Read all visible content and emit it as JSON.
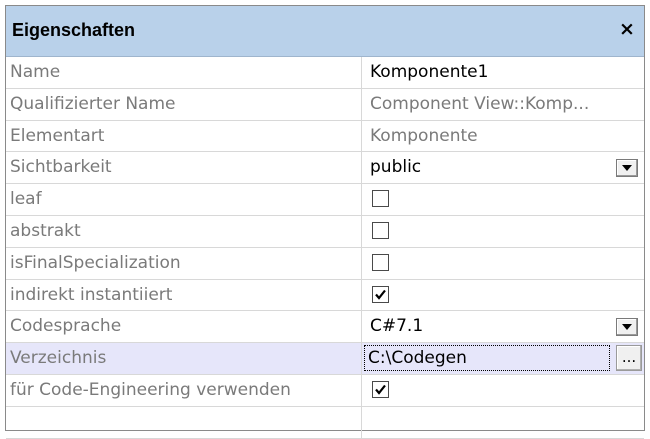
{
  "panel": {
    "title": "Eigenschaften",
    "close_label": "×"
  },
  "properties": {
    "name": {
      "label": "Name",
      "value": "Komponente1"
    },
    "qualified_name": {
      "label": "Qualifizierter Name",
      "value": "Component View::Komp..."
    },
    "element_type": {
      "label": "Elementart",
      "value": "Komponente"
    },
    "visibility": {
      "label": "Sichtbarkeit",
      "value": "public"
    },
    "leaf": {
      "label": "leaf",
      "checked": false
    },
    "abstract": {
      "label": "abstrakt",
      "checked": false
    },
    "is_final_specialization": {
      "label": "isFinalSpecialization",
      "checked": false
    },
    "indirectly_instantiated": {
      "label": "indirekt instantiiert",
      "checked": true
    },
    "code_language": {
      "label": "Codesprache",
      "value": "C#7.1"
    },
    "directory": {
      "label": "Verzeichnis",
      "value": "C:\\Codegen",
      "browse_label": "..."
    },
    "use_for_code_engineering": {
      "label": "für Code-Engineering verwenden",
      "checked": true
    }
  },
  "colors": {
    "title_bar": "#b9d1ea",
    "selected_row": "#e6e6fa",
    "label_text": "#7a7a7a"
  }
}
